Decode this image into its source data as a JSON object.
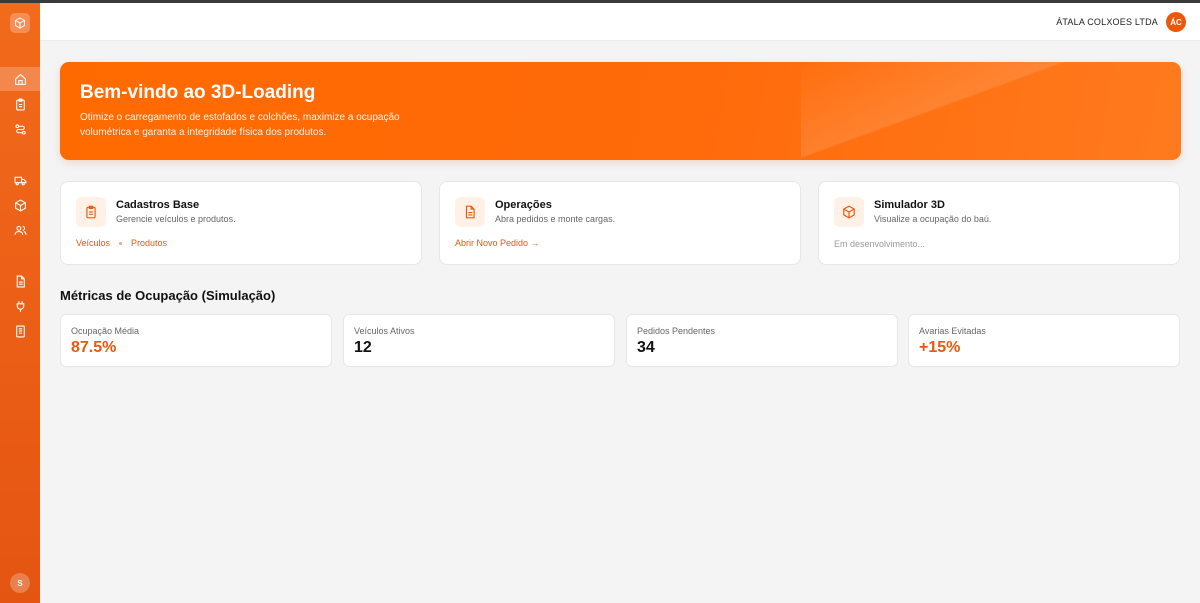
{
  "colors": {
    "accent": "#ea580c",
    "sidebar": "#f26a1b",
    "hero": "#ff6a00"
  },
  "sidebar": {
    "logo_icon": "cube-icon",
    "items": [
      {
        "icon": "home-icon",
        "active": true
      },
      {
        "icon": "clipboard-icon",
        "active": false
      },
      {
        "icon": "route-icon",
        "active": false
      },
      {
        "icon": "truck-icon",
        "active": false
      },
      {
        "icon": "box-icon",
        "active": false
      },
      {
        "icon": "users-icon",
        "active": false
      },
      {
        "icon": "document-icon",
        "active": false
      },
      {
        "icon": "plug-icon",
        "active": false
      },
      {
        "icon": "receipt-icon",
        "active": false
      }
    ],
    "user_initial": "S"
  },
  "topbar": {
    "company": "ÁTALA COLXOES LTDA",
    "user_initials": "ÁC"
  },
  "hero": {
    "title": "Bem-vindo ao 3D-Loading",
    "description": "Otimize o carregamento de estofados e colchões, maximize a ocupação volumétrica e garanta a integridade física dos produtos."
  },
  "cards": [
    {
      "title": "Cadastros Base",
      "subtitle": "Gerencie veículos e produtos.",
      "link1": "Veículos",
      "link2": "Produtos",
      "icon": "clipboard-icon"
    },
    {
      "title": "Operações",
      "subtitle": "Abra pedidos e monte cargas.",
      "link": "Abrir Novo Pedido →",
      "icon": "document-icon"
    },
    {
      "title": "Simulador 3D",
      "subtitle": "Visualize a ocupação do baú.",
      "status": "Em desenvolvimento...",
      "icon": "cube-icon"
    }
  ],
  "metrics_title": "Métricas de Ocupação (Simulação)",
  "metrics": [
    {
      "label": "Ocupação Média",
      "value": "87.5%"
    },
    {
      "label": "Veículos Ativos",
      "value": "12"
    },
    {
      "label": "Pedidos Pendentes",
      "value": "34"
    },
    {
      "label": "Avarias Evitadas",
      "value": "+15%"
    }
  ]
}
